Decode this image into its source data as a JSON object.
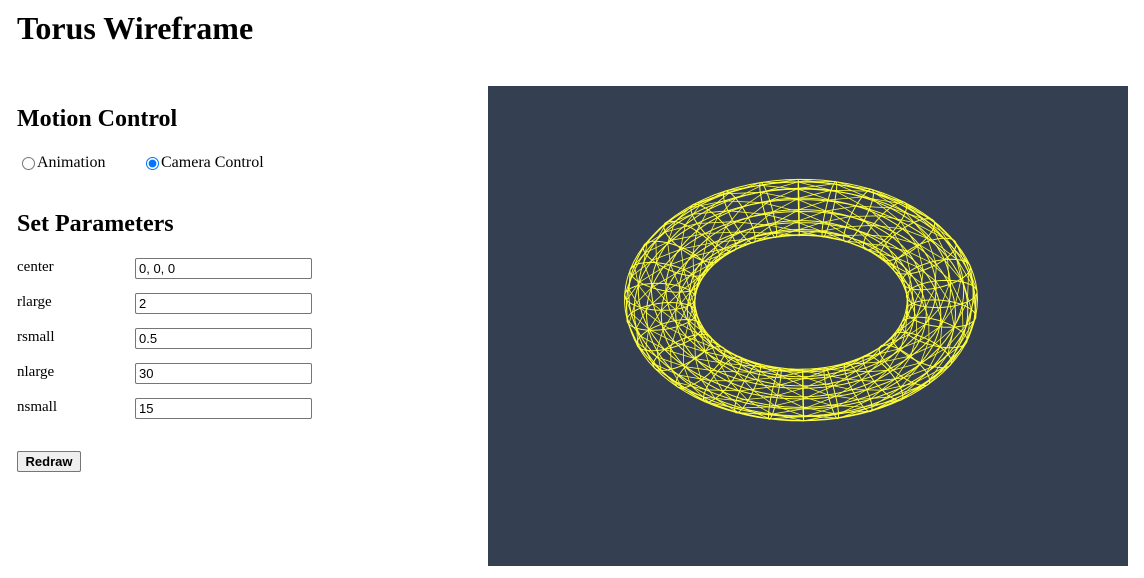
{
  "page": {
    "title": "Torus Wireframe"
  },
  "motion": {
    "title": "Motion Control",
    "options": [
      {
        "label": "Animation",
        "checked": false
      },
      {
        "label": "Camera Control",
        "checked": true
      }
    ]
  },
  "params": {
    "title": "Set Parameters",
    "fields": [
      {
        "label": "center",
        "value": "0, 0, 0"
      },
      {
        "label": "rlarge",
        "value": "2"
      },
      {
        "label": "rsmall",
        "value": "0.5"
      },
      {
        "label": "nlarge",
        "value": "30"
      },
      {
        "label": "nsmall",
        "value": "15"
      }
    ],
    "redraw_label": "Redraw"
  },
  "viewport": {
    "background": "#343f51",
    "wire_color": "#ffff33"
  }
}
